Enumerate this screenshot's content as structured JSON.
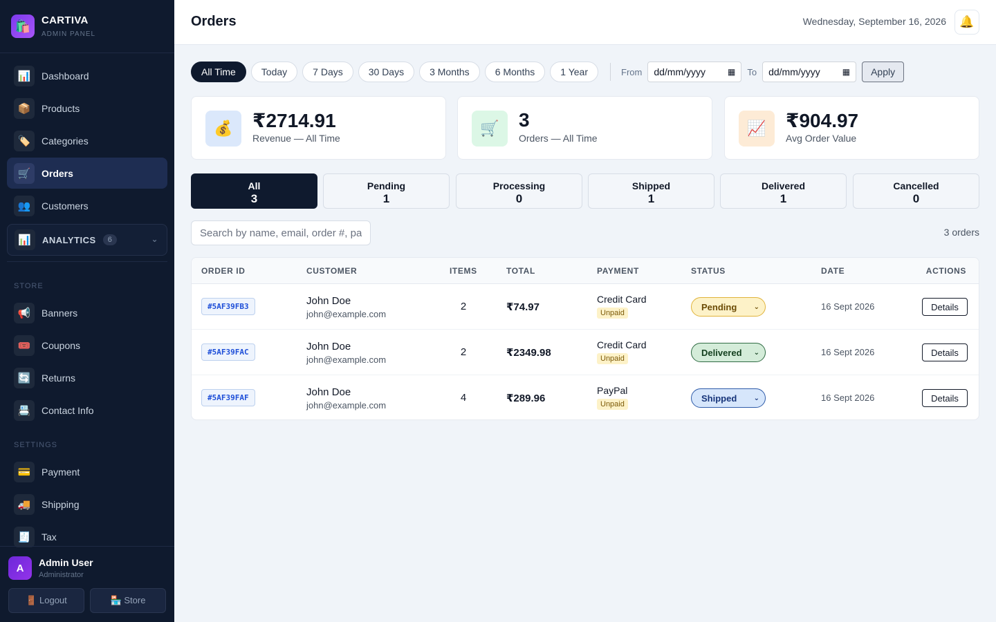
{
  "brand": {
    "name": "CARTIVA",
    "sub": "ADMIN PANEL",
    "logo_icon": "shopping-bags"
  },
  "nav_main": [
    {
      "label": "Dashboard",
      "icon": "📊",
      "active": false
    },
    {
      "label": "Products",
      "icon": "📦",
      "active": false
    },
    {
      "label": "Categories",
      "icon": "🏷️",
      "active": false
    },
    {
      "label": "Orders",
      "icon": "🛒",
      "active": true
    },
    {
      "label": "Customers",
      "icon": "👥",
      "active": false
    }
  ],
  "analytics": {
    "label": "ANALYTICS",
    "count": "6",
    "icon": "📊"
  },
  "store_section": {
    "label": "STORE",
    "items": [
      {
        "label": "Banners",
        "icon": "📢"
      },
      {
        "label": "Coupons",
        "icon": "🎟️"
      },
      {
        "label": "Returns",
        "icon": "🔄"
      },
      {
        "label": "Contact Info",
        "icon": "📇"
      }
    ]
  },
  "settings_section": {
    "label": "SETTINGS",
    "items": [
      {
        "label": "Payment",
        "icon": "💳"
      },
      {
        "label": "Shipping",
        "icon": "🚚"
      },
      {
        "label": "Tax",
        "icon": "🧾"
      }
    ]
  },
  "user": {
    "initial": "A",
    "name": "Admin User",
    "role": "Administrator",
    "logout": "🚪 Logout",
    "store": "🏪 Store"
  },
  "header": {
    "title": "Orders",
    "date": "Wednesday, September 16, 2026",
    "bell": "🔔"
  },
  "filters": {
    "ranges": [
      "All Time",
      "Today",
      "7 Days",
      "30 Days",
      "3 Months",
      "6 Months",
      "1 Year"
    ],
    "active_range": "All Time",
    "from_label": "From",
    "to_label": "To",
    "from_value": "dd/mm/yyyy",
    "to_value": "dd/mm/yyyy",
    "apply": "Apply"
  },
  "stats": [
    {
      "value": "₹2714.91",
      "label": "Revenue — All Time",
      "icon": "💰",
      "bg": "#dbe8fb"
    },
    {
      "value": "3",
      "label": "Orders — All Time",
      "icon": "🛒",
      "bg": "#dcf7e6"
    },
    {
      "value": "₹904.97",
      "label": "Avg Order Value",
      "icon": "📈",
      "bg": "#fdebd6"
    }
  ],
  "status_tabs": [
    {
      "label": "All",
      "count": "3",
      "active": true
    },
    {
      "label": "Pending",
      "count": "1",
      "active": false
    },
    {
      "label": "Processing",
      "count": "0",
      "active": false
    },
    {
      "label": "Shipped",
      "count": "1",
      "active": false
    },
    {
      "label": "Delivered",
      "count": "1",
      "active": false
    },
    {
      "label": "Cancelled",
      "count": "0",
      "active": false
    }
  ],
  "search": {
    "placeholder": "Search by name, email, order #, payment..."
  },
  "order_count": "3 orders",
  "table": {
    "columns": [
      "ORDER ID",
      "CUSTOMER",
      "ITEMS",
      "TOTAL",
      "PAYMENT",
      "STATUS",
      "DATE",
      "ACTIONS"
    ],
    "rows": [
      {
        "id": "#5AF39FB3",
        "name": "John Doe",
        "email": "john@example.com",
        "items": "2",
        "total": "₹74.97",
        "payment": "Credit Card",
        "pay_status": "Unpaid",
        "status": "Pending",
        "date": "16 Sept 2026",
        "action": "Details"
      },
      {
        "id": "#5AF39FAC",
        "name": "John Doe",
        "email": "john@example.com",
        "items": "2",
        "total": "₹2349.98",
        "payment": "Credit Card",
        "pay_status": "Unpaid",
        "status": "Delivered",
        "date": "16 Sept 2026",
        "action": "Details"
      },
      {
        "id": "#5AF39FAF",
        "name": "John Doe",
        "email": "john@example.com",
        "items": "4",
        "total": "₹289.96",
        "payment": "PayPal",
        "pay_status": "Unpaid",
        "status": "Shipped",
        "date": "16 Sept 2026",
        "action": "Details"
      }
    ]
  }
}
